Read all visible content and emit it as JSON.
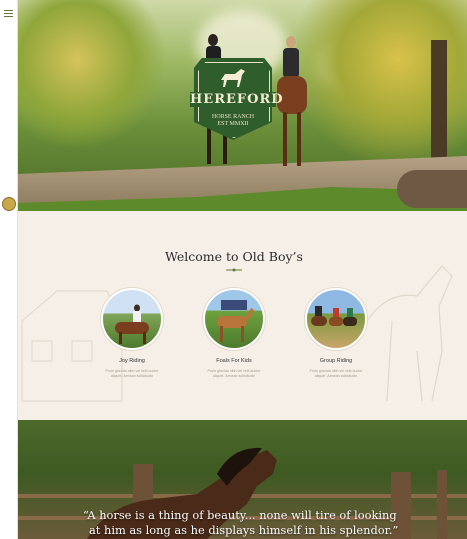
{
  "nav": {
    "menu_icon": "hamburger-icon",
    "logo_icon": "badge-icon"
  },
  "hero": {
    "logo": {
      "name": "HEREFORD",
      "sub_line1": "HORSE RANCH",
      "sub_line2": "EST MMXII"
    }
  },
  "welcome": {
    "title": "Welcome to Old Boy’s",
    "cards": [
      {
        "label": "Joy Riding",
        "desc_line1": "Proin gravida nibh vel velit auctor",
        "desc_line2": "aliquet. Aenean sollicitudin"
      },
      {
        "label": "Foals For Kids",
        "desc_line1": "Proin gravida nibh vel velit auctor",
        "desc_line2": "aliquet. Aenean sollicitudin"
      },
      {
        "label": "Group Riding",
        "desc_line1": "Proin gravida nibh vel velit auctor",
        "desc_line2": "aliquet. Aenean sollicitudin"
      }
    ]
  },
  "quote": {
    "line1": "“A horse is a thing of beauty... none will tire of looking",
    "line2": "at him as long as he displays himself in his splendor.”"
  },
  "colors": {
    "accent": "#2f5d2c",
    "background": "#f6efe7"
  }
}
